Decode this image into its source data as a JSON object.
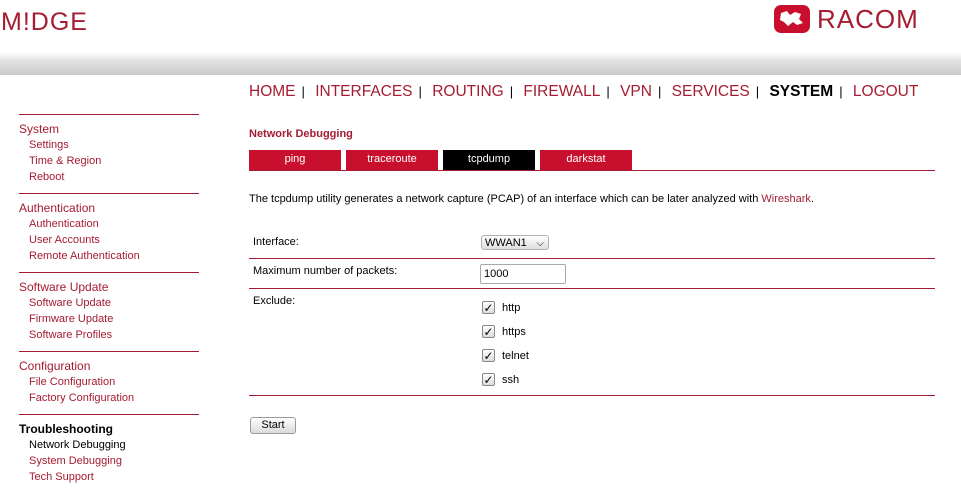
{
  "brand": {
    "left_logo": "M!DGE",
    "right_logo": "RACOM",
    "logo_color": "#a51c30"
  },
  "topnav": [
    "HOME",
    "INTERFACES",
    "ROUTING",
    "FIREWALL",
    "VPN",
    "SERVICES",
    "SYSTEM",
    "LOGOUT"
  ],
  "topnav_active": "SYSTEM",
  "sidebar": {
    "groups": [
      {
        "title": "System",
        "items": [
          "Settings",
          "Time & Region",
          "Reboot"
        ]
      },
      {
        "title": "Authentication",
        "items": [
          "Authentication",
          "User Accounts",
          "Remote Authentication"
        ]
      },
      {
        "title": "Software Update",
        "items": [
          "Software Update",
          "Firmware Update",
          "Software Profiles"
        ]
      },
      {
        "title": "Configuration",
        "items": [
          "File Configuration",
          "Factory Configuration"
        ]
      },
      {
        "title": "Troubleshooting",
        "items": [
          "Network Debugging",
          "System Debugging",
          "Tech Support"
        ]
      }
    ],
    "active_group": "Troubleshooting",
    "active_item": "Network Debugging"
  },
  "main": {
    "title": "Network Debugging",
    "tabs": [
      "ping",
      "traceroute",
      "tcpdump",
      "darkstat"
    ],
    "active_tab": "tcpdump",
    "description_text": "The tcpdump utility generates a network capture (PCAP) of an interface which can be later analyzed with ",
    "description_link": "Wireshark",
    "description_end": ".",
    "form": {
      "interface_label": "Interface:",
      "interface_value": "WWAN1",
      "packets_label": "Maximum number of packets:",
      "packets_value": "1000",
      "exclude_label": "Exclude:",
      "exclude_options": [
        {
          "label": "http",
          "checked": true
        },
        {
          "label": "https",
          "checked": true
        },
        {
          "label": "telnet",
          "checked": true
        },
        {
          "label": "ssh",
          "checked": true
        }
      ]
    },
    "start_button": "Start"
  }
}
